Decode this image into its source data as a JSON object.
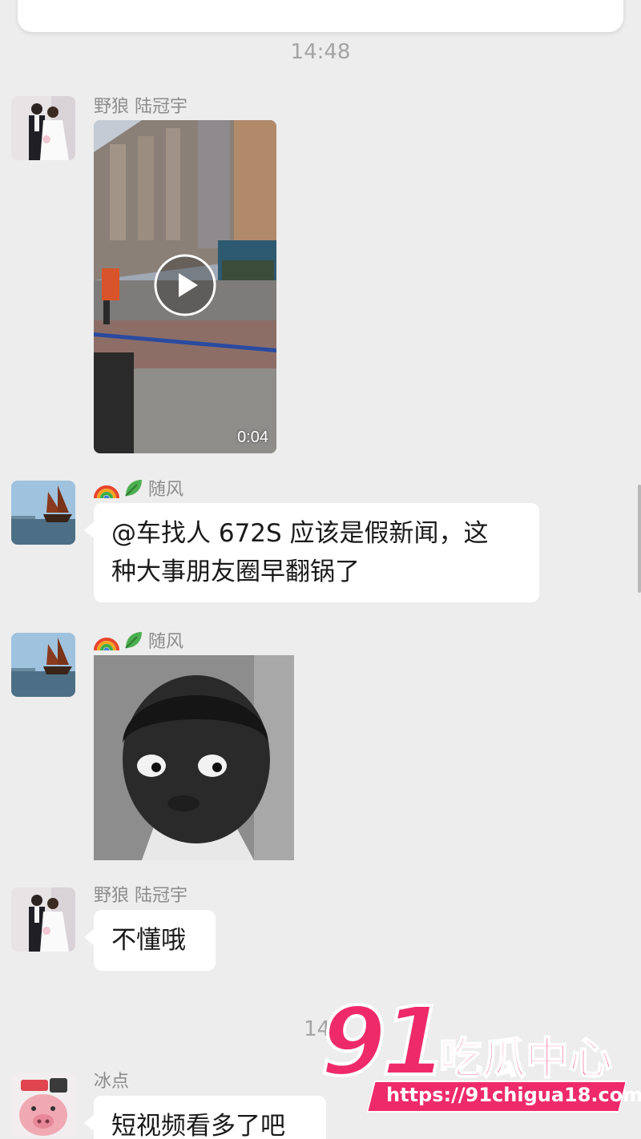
{
  "timestamps": {
    "first": "14:48",
    "second": "14:"
  },
  "video_message": {
    "sender": "野狼 陆冠宇",
    "duration": "0:04"
  },
  "text_message_1": {
    "sender": "随风",
    "line1": "@车找人 672S 应该是假新闻，这",
    "line2": "种大事朋友圈早翻锅了"
  },
  "sticker_message": {
    "sender": "随风"
  },
  "text_message_2": {
    "sender": "野狼 陆冠宇",
    "text": "不懂哦"
  },
  "text_message_3": {
    "sender": "冰点",
    "text": "短视频看多了吧"
  },
  "watermark": {
    "number": "91",
    "title": "吃瓜中心",
    "url": "https://91chigua18.com"
  },
  "colors": {
    "background": "#ededed",
    "bubble": "#ffffff",
    "watermark_pink": "#ee2a6b"
  }
}
